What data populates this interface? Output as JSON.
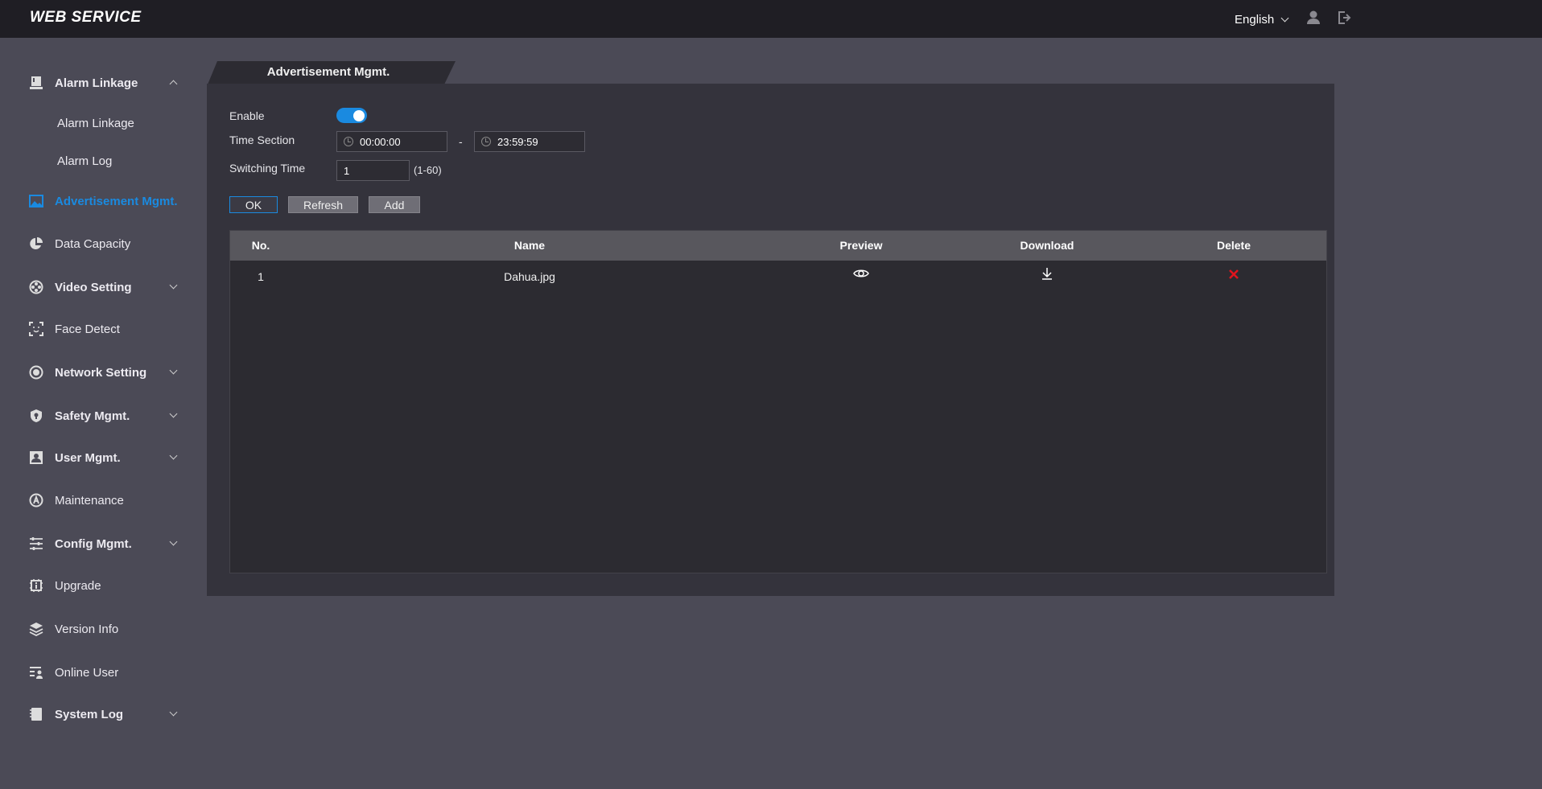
{
  "header": {
    "title": "WEB SERVICE",
    "language": "English",
    "icons": [
      "user-icon",
      "logout-icon"
    ]
  },
  "sidebar": {
    "items": [
      {
        "label": "Alarm Linkage",
        "icon": "alarm-icon",
        "expandable": true,
        "expanded": true
      },
      {
        "label": "Alarm Linkage",
        "sub": true
      },
      {
        "label": "Alarm Log",
        "sub": true
      },
      {
        "label": "Advertisement Mgmt.",
        "icon": "image-icon",
        "active": true
      },
      {
        "label": "Data Capacity",
        "icon": "pie-chart-icon"
      },
      {
        "label": "Video Setting",
        "icon": "film-reel-icon",
        "expandable": true
      },
      {
        "label": "Face Detect",
        "icon": "face-detect-icon"
      },
      {
        "label": "Network Setting",
        "icon": "network-icon",
        "expandable": true
      },
      {
        "label": "Safety Mgmt.",
        "icon": "shield-icon",
        "expandable": true
      },
      {
        "label": "User Mgmt.",
        "icon": "user-card-icon",
        "expandable": true
      },
      {
        "label": "Maintenance",
        "icon": "maintenance-icon"
      },
      {
        "label": "Config Mgmt.",
        "icon": "sliders-icon",
        "expandable": true
      },
      {
        "label": "Upgrade",
        "icon": "chip-icon"
      },
      {
        "label": "Version Info",
        "icon": "layers-icon"
      },
      {
        "label": "Online User",
        "icon": "online-user-icon"
      },
      {
        "label": "System Log",
        "icon": "notebook-icon",
        "expandable": true
      }
    ]
  },
  "main": {
    "tab": "Advertisement Mgmt.",
    "form": {
      "enable_label": "Enable",
      "enable": true,
      "time_section_label": "Time Section",
      "start_time": "00:00:00",
      "separator": "-",
      "end_time": "23:59:59",
      "switching_time_label": "Switching Time",
      "switching_time": "1",
      "switching_range": "(1-60)"
    },
    "buttons": {
      "ok": "OK",
      "refresh": "Refresh",
      "add": "Add"
    },
    "table": {
      "columns": [
        "No.",
        "Name",
        "Preview",
        "Download",
        "Delete"
      ],
      "rows": [
        {
          "no": "1",
          "name": "Dahua.jpg"
        }
      ]
    }
  },
  "colors": {
    "accent": "#1a8ae0",
    "delete": "#e0141e"
  }
}
